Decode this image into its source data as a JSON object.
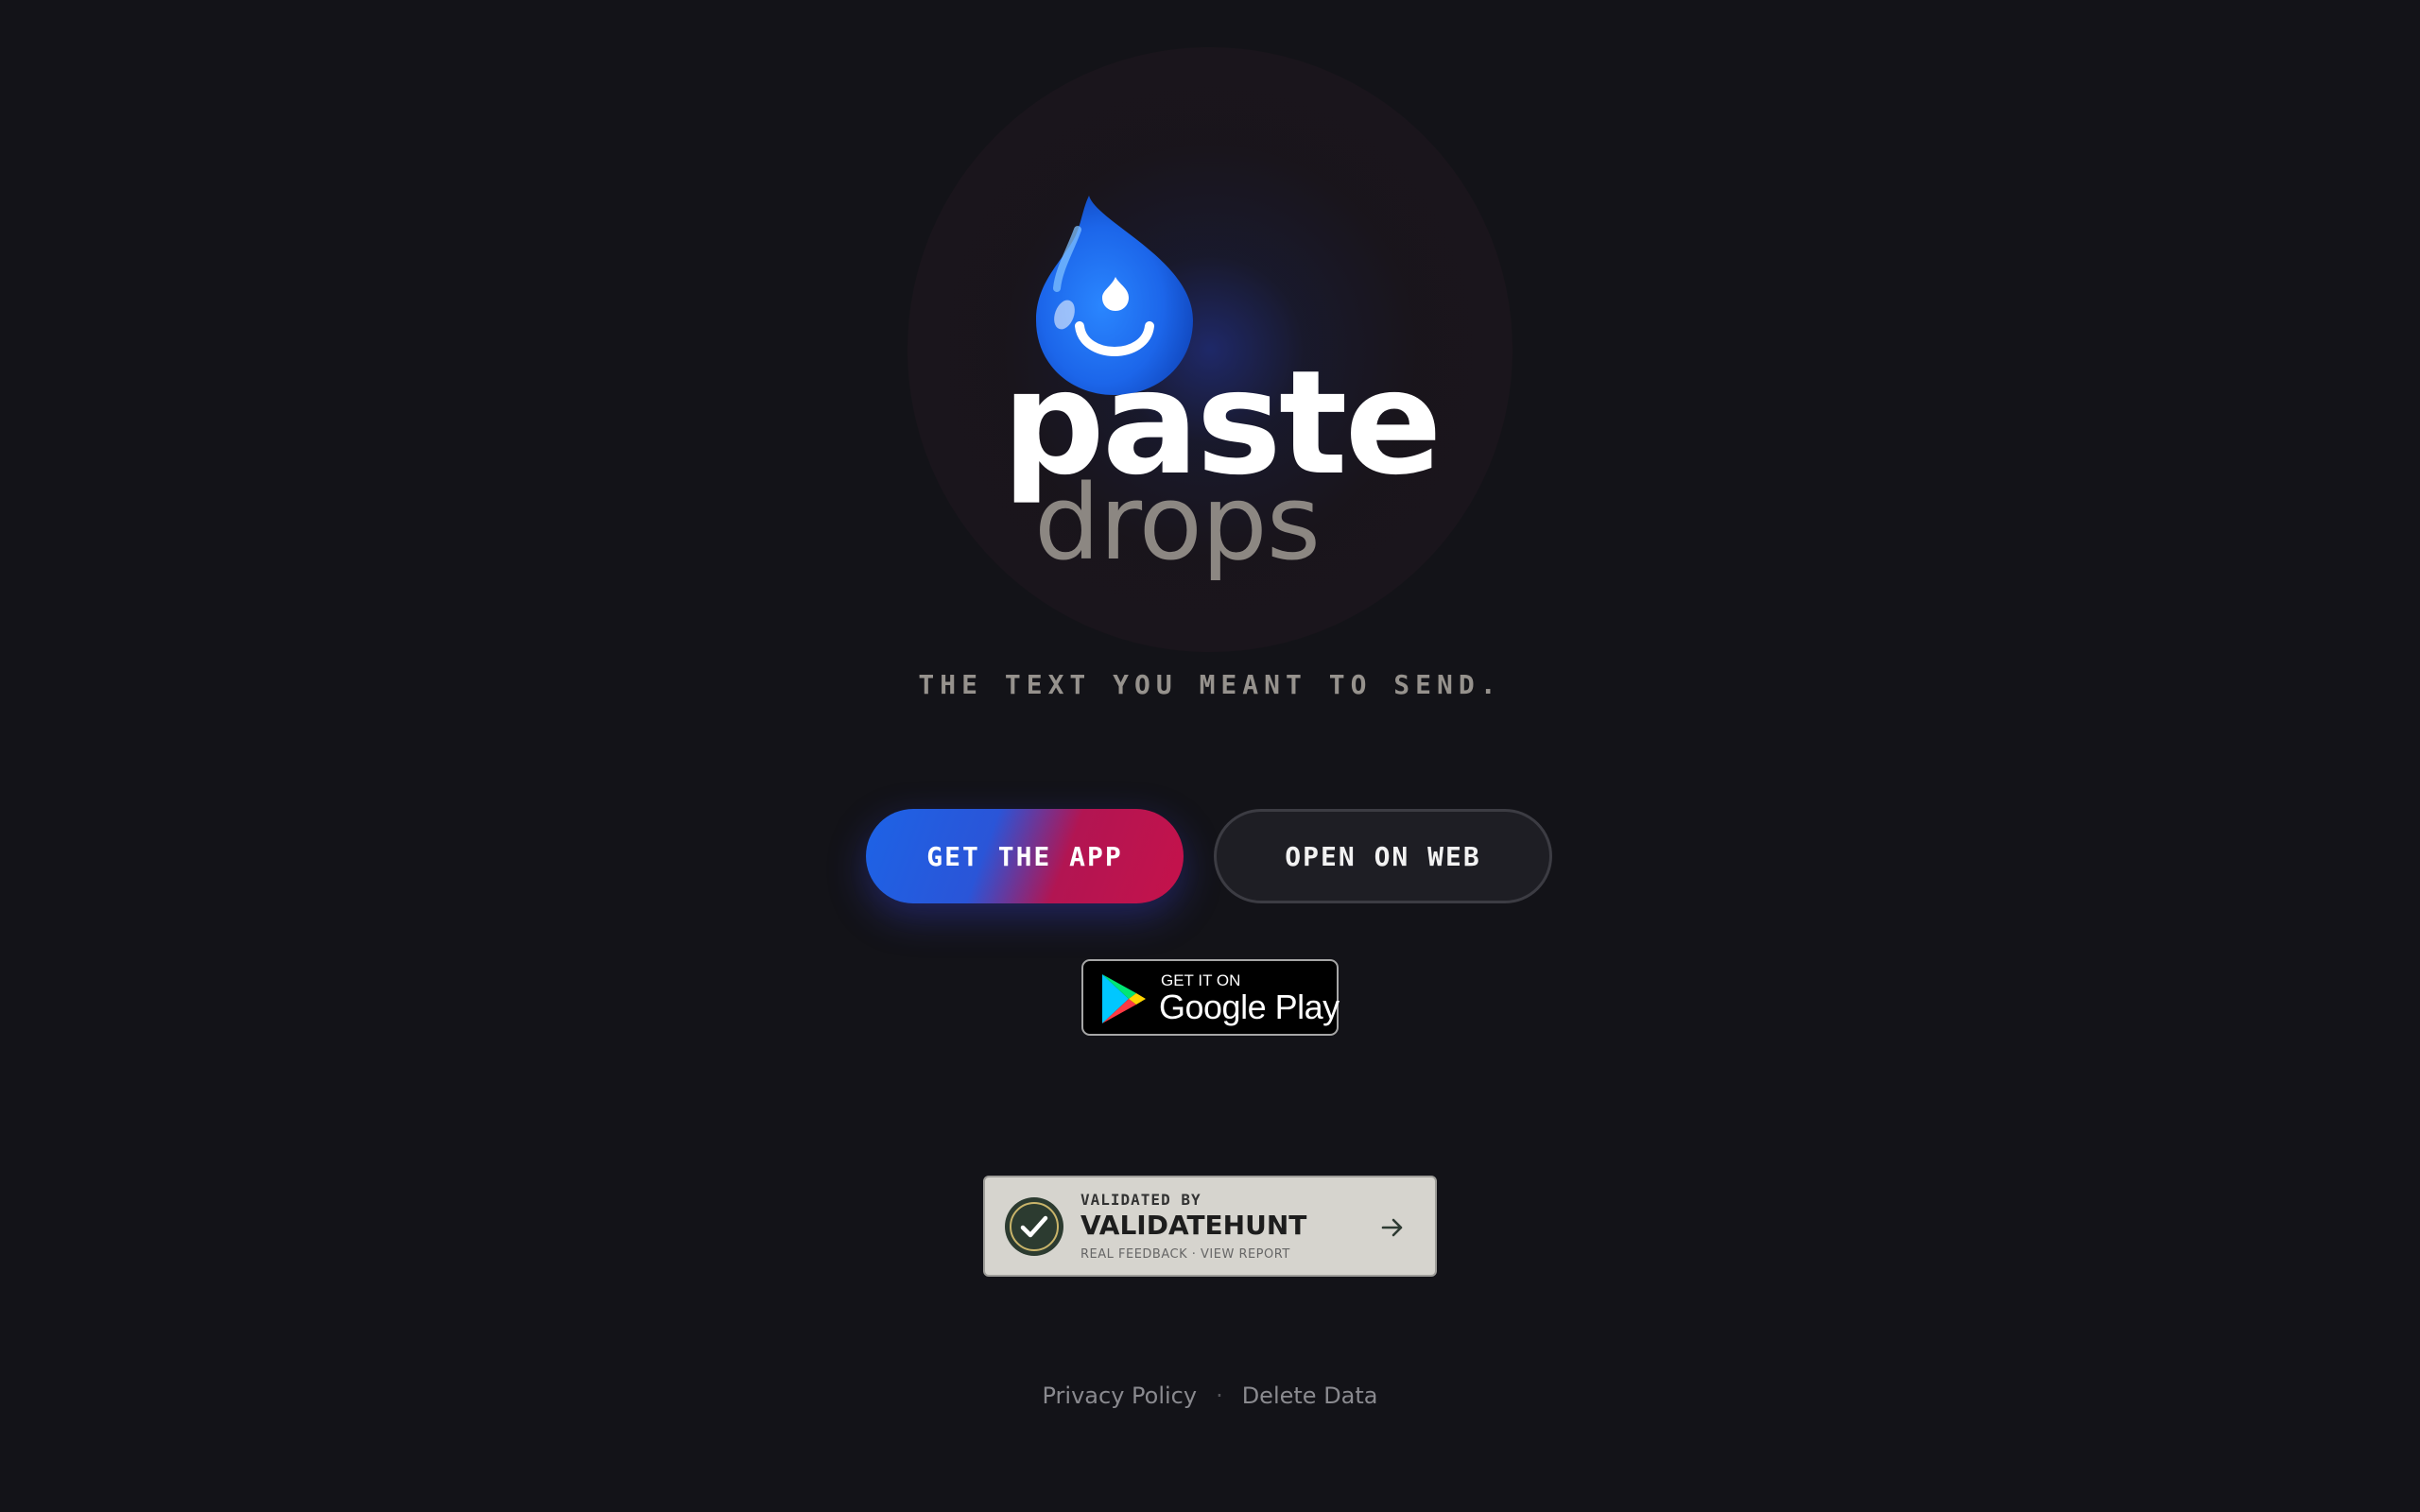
{
  "brand": {
    "word1": "paste",
    "word2": "drops",
    "tagline": "THE TEXT YOU MEANT TO SEND."
  },
  "actions": {
    "get_app_label": "GET THE APP",
    "open_web_label": "OPEN ON WEB"
  },
  "google_play": {
    "small_text": "GET IT ON",
    "big_text": "Google Play"
  },
  "validate_badge": {
    "line1": "VALIDATED BY",
    "line2": "VALIDATEHUNT",
    "line3": "REAL FEEDBACK · VIEW REPORT"
  },
  "footer": {
    "privacy_label": "Privacy Policy",
    "separator": "·",
    "delete_label": "Delete Data"
  },
  "colors": {
    "background": "#131318",
    "drop_blue": "#1f6ff0",
    "accent_red": "#c5124b",
    "tagline": "#96928d"
  },
  "icons": {
    "logo": "water-drop-smile-icon",
    "play": "google-play-icon",
    "check": "check-badge-icon",
    "arrow": "arrow-right-icon"
  }
}
